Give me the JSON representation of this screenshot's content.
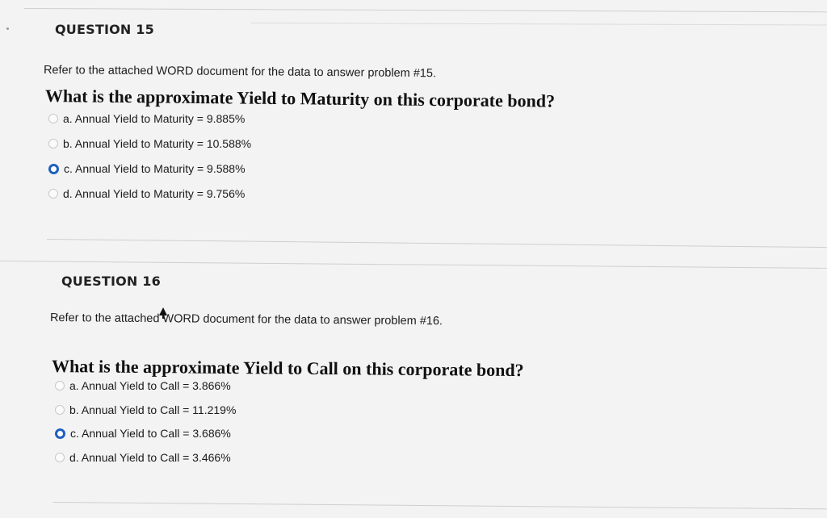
{
  "questions": [
    {
      "header": "QUESTION 15",
      "instruction": "Refer to the attached WORD document for the data to answer problem #15.",
      "prompt": "What is the approximate Yield to Maturity on this corporate bond?",
      "options": [
        {
          "label": "a. Annual Yield to Maturity = 9.885%",
          "selected": false
        },
        {
          "label": "b. Annual Yield to Maturity = 10.588%",
          "selected": false
        },
        {
          "label": "c. Annual Yield to Maturity = 9.588%",
          "selected": true
        },
        {
          "label": "d. Annual Yield to Maturity = 9.756%",
          "selected": false
        }
      ]
    },
    {
      "header": "QUESTION 16",
      "instruction": "Refer to the attached WORD document for the data to answer problem #16.",
      "prompt": "What is the approximate Yield to Call on this corporate bond?",
      "options": [
        {
          "label": "a. Annual Yield to Call = 3.866%",
          "selected": false
        },
        {
          "label": "b. Annual Yield to Call = 11.219%",
          "selected": false
        },
        {
          "label": "c. Annual Yield to Call = 3.686%",
          "selected": true
        },
        {
          "label": "d. Annual Yield to Call = 3.466%",
          "selected": false
        }
      ]
    }
  ],
  "colors": {
    "selected_radio": "#1f5fbf",
    "background": "#f3f3f4",
    "divider": "#cfcfd2"
  }
}
